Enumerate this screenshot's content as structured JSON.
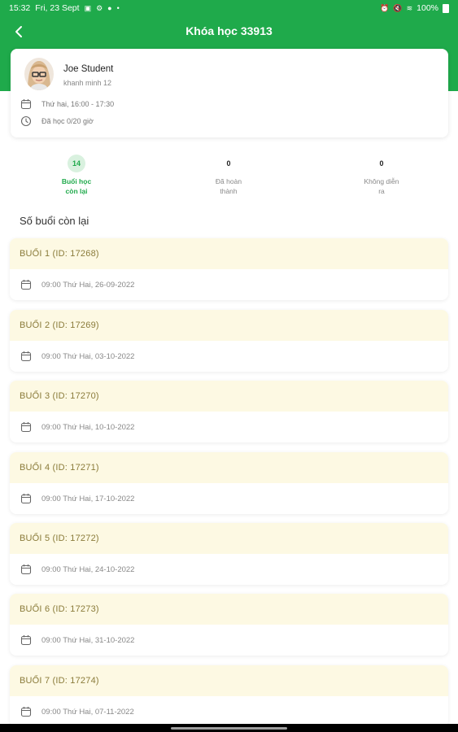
{
  "status_bar": {
    "time": "15:32",
    "date": "Fri, 23 Sept",
    "battery": "100%"
  },
  "header": {
    "title": "Khóa học 33913",
    "back_icon": "chevron-left-icon"
  },
  "student": {
    "name": "Joe Student",
    "subtitle": "khanh minh 12",
    "schedule": "Thứ hai, 16:00 - 17:30",
    "progress": "Đã học 0/20 giờ"
  },
  "stats": [
    {
      "count": "14",
      "label": "Buổi học còn lại",
      "active": true
    },
    {
      "count": "0",
      "label": "Đã hoàn thành",
      "active": false
    },
    {
      "count": "0",
      "label": "Không diễn ra",
      "active": false
    }
  ],
  "section_title": "Số buổi còn lại",
  "sessions": [
    {
      "title": "BUỔI 1 (ID: 17268)",
      "time": "09:00 Thứ Hai, 26-09-2022"
    },
    {
      "title": "BUỔI 2 (ID: 17269)",
      "time": "09:00 Thứ Hai, 03-10-2022"
    },
    {
      "title": "BUỔI 3 (ID: 17270)",
      "time": "09:00 Thứ Hai, 10-10-2022"
    },
    {
      "title": "BUỔI 4 (ID: 17271)",
      "time": "09:00 Thứ Hai, 17-10-2022"
    },
    {
      "title": "BUỔI 5 (ID: 17272)",
      "time": "09:00 Thứ Hai, 24-10-2022"
    },
    {
      "title": "BUỔI 6 (ID: 17273)",
      "time": "09:00 Thứ Hai, 31-10-2022"
    },
    {
      "title": "BUỔI 7 (ID: 17274)",
      "time": "09:00 Thứ Hai, 07-11-2022"
    }
  ],
  "colors": {
    "primary_green": "#1faa4b",
    "session_header_bg": "#fdf9e3",
    "session_header_text": "#8a7b3a"
  }
}
